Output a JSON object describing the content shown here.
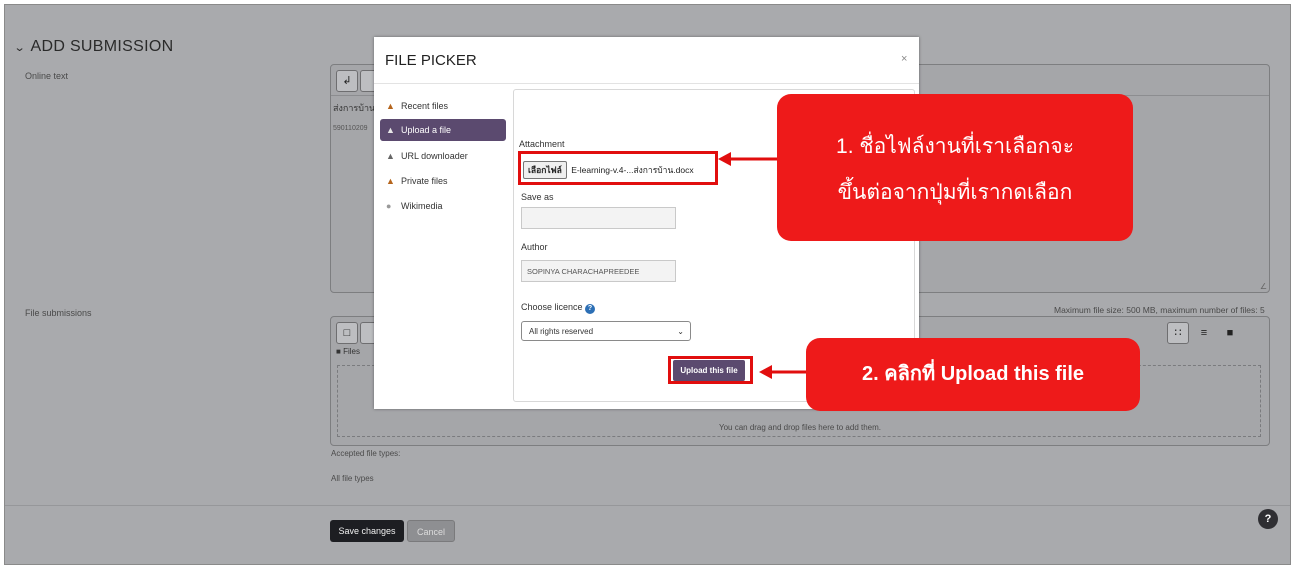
{
  "section": {
    "title": "ADD SUBMISSION"
  },
  "online_text": {
    "label": "Online text",
    "editor_line1": "ส่งการบ้าน",
    "editor_line2": "590110209"
  },
  "file_submissions": {
    "label": "File submissions",
    "limit_text": "Maximum file size: 500 MB, maximum number of files: 5",
    "files_label": "Files",
    "drop_hint": "You can drag and drop files here to add them."
  },
  "accepted": {
    "label": "Accepted file types:",
    "value": "All file types"
  },
  "actions": {
    "save": "Save changes",
    "cancel": "Cancel"
  },
  "help": {
    "label": "?"
  },
  "file_picker": {
    "title": "FILE PICKER",
    "close": "×",
    "repositories": [
      {
        "label": "Recent files",
        "icon": "recent-files-icon"
      },
      {
        "label": "Upload a file",
        "icon": "upload-icon",
        "active": true
      },
      {
        "label": "URL downloader",
        "icon": "url-downloader-icon"
      },
      {
        "label": "Private files",
        "icon": "private-files-icon"
      },
      {
        "label": "Wikimedia",
        "icon": "wikimedia-icon"
      }
    ],
    "attachment_label": "Attachment",
    "choose_file_button": "เลือกไฟล์",
    "chosen_file": "E-learning-v.4-...ส่งการบ้าน.docx",
    "save_as_label": "Save as",
    "save_as_value": "",
    "author_label": "Author",
    "author_value": "SOPINYA CHARACHAPREEDEE",
    "licence_label": "Choose licence",
    "licence_value": "All rights reserved",
    "upload_button": "Upload this file"
  },
  "annotations": {
    "callout1_line1": "1. ชื่อไฟล์งานที่เราเลือกจะ",
    "callout1_line2": "ขึ้นต่อจากปุ่มที่เรากดเลือก",
    "callout2": "2. คลิกที่ Upload this file"
  },
  "colors": {
    "accent": "#5b4a6f",
    "annotation_red": "#ee1a1a",
    "overlay": "#a9aaad"
  }
}
